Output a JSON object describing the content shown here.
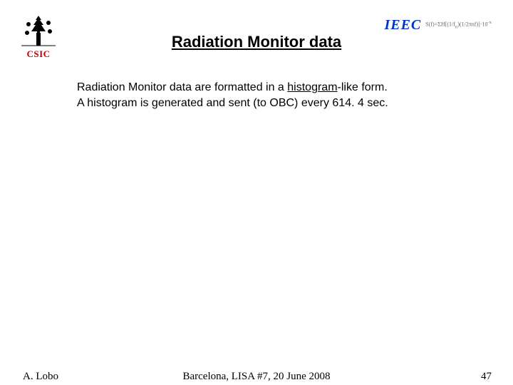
{
  "header": {
    "logo_left_label": "CSIC",
    "title": "Radiation Monitor data",
    "logo_right_label": "IEEC"
  },
  "body": {
    "line1_a": "Radiation Monitor data are formatted in a ",
    "line1_b": "histogram",
    "line1_c": "-like form.",
    "line2": "A histogram is generated and sent (to OBC) every 614. 4 sec."
  },
  "footer": {
    "author": "A. Lobo",
    "venue": "Barcelona, LISA #7, 20 June 2008",
    "page": "47"
  }
}
